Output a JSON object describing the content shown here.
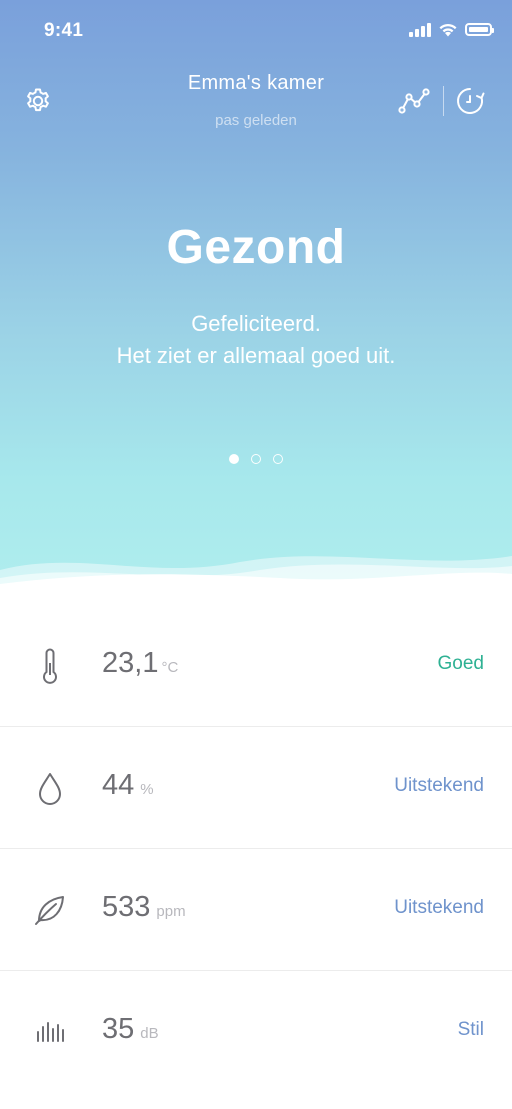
{
  "status_bar": {
    "time": "9:41"
  },
  "header": {
    "title": "Emma's kamer",
    "subtitle": "pas geleden",
    "icons": [
      "gear-icon",
      "trend-chart-icon",
      "history-icon"
    ]
  },
  "hero": {
    "heading": "Gezond",
    "message_line1": "Gefeliciteerd.",
    "message_line2": "Het ziet er allemaal goed uit.",
    "pages": 3,
    "active_page": 1
  },
  "metrics": [
    {
      "icon": "thermometer-icon",
      "value": "23,1",
      "unit": "°C",
      "rating": "Goed",
      "rating_color": "#2eb193"
    },
    {
      "icon": "humidity-drop-icon",
      "value": "44",
      "unit": "%",
      "rating": "Uitstekend",
      "rating_color": "#6f93cc"
    },
    {
      "icon": "leaf-icon",
      "value": "533",
      "unit": "ppm",
      "rating": "Uitstekend",
      "rating_color": "#6f93cc"
    },
    {
      "icon": "sound-level-icon",
      "value": "35",
      "unit": "dB",
      "rating": "Stil",
      "rating_color": "#6f93cc"
    }
  ],
  "colors": {
    "gradient_top": "#7aa0db",
    "gradient_bottom": "#b0eeee",
    "good": "#2eb193",
    "excellent": "#6f93cc"
  }
}
